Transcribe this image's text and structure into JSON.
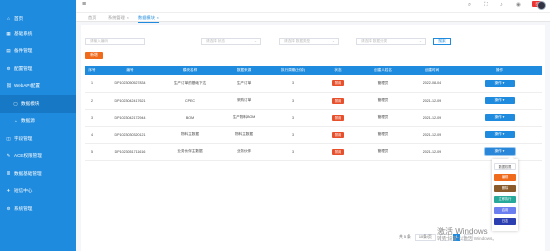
{
  "sidebar": {
    "items": [
      {
        "icon": "home-icon",
        "glyph": "⌂",
        "label": "首页"
      },
      {
        "icon": "grid-icon",
        "glyph": "▦",
        "label": "基础系统"
      },
      {
        "icon": "book-icon",
        "glyph": "▤",
        "label": "备件管理"
      },
      {
        "icon": "gear-icon",
        "glyph": "⚙",
        "label": "配置管理"
      },
      {
        "icon": "link-icon",
        "glyph": "⛓",
        "label": "WebAPI配置"
      },
      {
        "icon": "doc-icon",
        "glyph": "▢",
        "label": "数据模块"
      },
      {
        "icon": "person-icon",
        "glyph": "◔",
        "label": "数据源"
      },
      {
        "icon": "chart-icon",
        "glyph": "◫",
        "label": "字段管理"
      },
      {
        "icon": "wrench-icon",
        "glyph": "✎",
        "label": "ACE权限管理"
      },
      {
        "icon": "list-icon",
        "glyph": "≣",
        "label": "数据基础管理"
      },
      {
        "icon": "send-icon",
        "glyph": "✈",
        "label": "短信中心"
      },
      {
        "icon": "settings-icon",
        "glyph": "⚙",
        "label": "系统管理"
      }
    ]
  },
  "tabs": [
    {
      "label": "首页"
    },
    {
      "label": "系统管理"
    },
    {
      "label": "数据模块"
    }
  ],
  "top_badge": "日",
  "filters": {
    "keyword_placeholder": "请输入编码",
    "status_placeholder": "请选择 状态",
    "type_placeholder": "请选择 数据类型",
    "category_placeholder": "请选择 数据分类"
  },
  "search_label": "搜索",
  "add_label": "新增",
  "table": {
    "headers": [
      "序号",
      "编号",
      "模块名称",
      "数据来源",
      "执行周期(分钟)",
      "状态",
      "创建人姓名",
      "创建时间",
      "操作"
    ],
    "rows": [
      {
        "no": "1",
        "code": "DP1023050527834",
        "name": "生产订单的基础下达",
        "source": "生产订单",
        "period": "3",
        "status": "禁用",
        "creator": "管理员",
        "time": "2022-08-04",
        "action": "操作 ▾"
      },
      {
        "no": "2",
        "code": "DP1023042417621",
        "name": "CPEC",
        "source": "采购订单",
        "period": "3",
        "status": "禁用",
        "creator": "管理员",
        "time": "2021-12-09",
        "action": "操作 ▾"
      },
      {
        "no": "3",
        "code": "DP1023042172944",
        "name": "BOM",
        "source": "生产物料BOM",
        "period": "3",
        "status": "禁用",
        "creator": "管理员",
        "time": "2021-12-09",
        "action": "操作 ▾"
      },
      {
        "no": "4",
        "code": "DP1023030320121",
        "name": "物料主数据",
        "source": "物料主数据",
        "period": "3",
        "status": "禁用",
        "creator": "管理员",
        "time": "2021-12-09",
        "action": "操作 ▾"
      },
      {
        "no": "5",
        "code": "DP1023051711616",
        "name": "业务伙伴主数据",
        "source": "业务伙伴",
        "period": "3",
        "status": "禁用",
        "creator": "管理员",
        "time": "2021-12-09",
        "action": "操作 ▾"
      }
    ]
  },
  "dropdown": {
    "items": [
      {
        "label": "数据权限",
        "color": "#ffffff",
        "text_color": "#555555"
      },
      {
        "label": "编辑",
        "color": "#f06a1c",
        "text_color": "#ffffff"
      },
      {
        "label": "删除",
        "color": "#8a5a2a",
        "text_color": "#ffffff"
      },
      {
        "label": "立即执行",
        "color": "#26a99a",
        "text_color": "#ffffff"
      },
      {
        "label": "启用",
        "color": "#6b7ff0",
        "text_color": "#ffffff"
      },
      {
        "label": "日志",
        "color": "#2b3fb0",
        "text_color": "#ffffff"
      }
    ]
  },
  "pager": {
    "total": "共 5 条",
    "page_size": "10条/页",
    "prev": "‹",
    "current": "1",
    "next": "›"
  },
  "watermark": {
    "line1": "激活 Windows",
    "line2": "转到\"设置\"以激活 Windows。"
  },
  "colors": {
    "primary": "#1f8bde",
    "danger": "#e8502c",
    "add": "#f06a1c"
  }
}
